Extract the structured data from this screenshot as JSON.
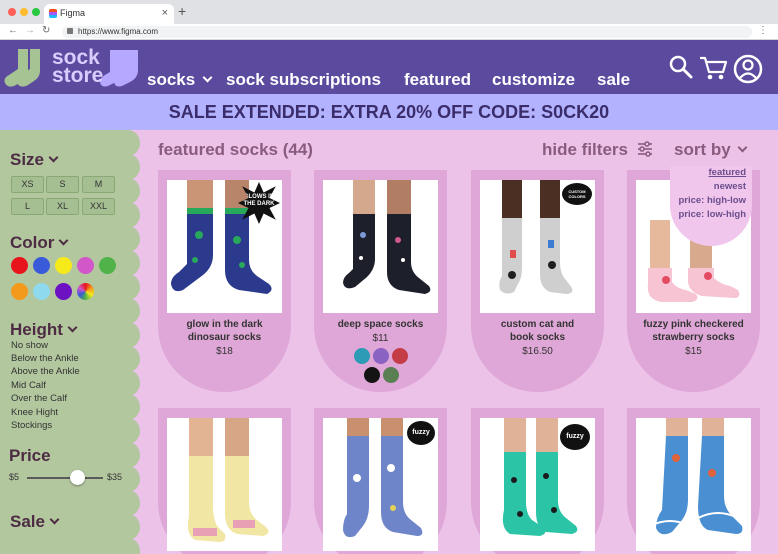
{
  "browser": {
    "tab_title": "Figma",
    "url": "https://www.figma.com"
  },
  "header": {
    "logo_text_line1": "sock",
    "logo_text_line2": "store",
    "nav": [
      {
        "label": "socks"
      },
      {
        "label": "sock subscriptions"
      },
      {
        "label": "featured"
      },
      {
        "label": "customize"
      },
      {
        "label": "sale"
      }
    ]
  },
  "banner": {
    "text": "SALE EXTENDED: EXTRA 20% OFF CODE: S0CK20"
  },
  "sidebar": {
    "size_label": "Size",
    "sizes": [
      "XS",
      "S",
      "M",
      "L",
      "XL",
      "XXL"
    ],
    "color_label": "Color",
    "colors": [
      "#e8141c",
      "#3a5bd9",
      "#f6ea1a",
      "#d257c8",
      "#4fb34a",
      "#f39a1d",
      "#8fd9ee",
      "#6d12c2",
      "multicolor"
    ],
    "height_label": "Height",
    "heights": [
      "No show",
      "Below the Ankle",
      "Above the Ankle",
      "Mid Calf",
      "Over the Calf",
      "Knee Hight",
      "Stockings"
    ],
    "price_label": "Price",
    "price_min": "$5",
    "price_max": "$35",
    "price_slider_fraction": 0.67,
    "sale_label": "Sale"
  },
  "content": {
    "title": "featured socks (44)",
    "hide_filters": "hide filters",
    "sort_by": "sort by",
    "sort_options": [
      "featured",
      "newest",
      "price: high-low",
      "price: low-high"
    ],
    "sort_selected": "featured"
  },
  "products": [
    {
      "name_line1": "glow in the dark",
      "name_line2": "dinosaur socks",
      "price": "$18",
      "badge": "GLOWS IN THE DARK",
      "sock_color": "#2b3a8c",
      "accent": "#28a85a",
      "bg": "#ffffff"
    },
    {
      "name_line1": "deep space socks",
      "name_line2": "",
      "price": "$11",
      "color_options": [
        "#2e9bb6",
        "#8a62c2",
        "#c43d46",
        "#141414",
        "#597f53"
      ],
      "sock_color": "#1d1f2b",
      "accent": "#7b9ad6",
      "bg": "#ffffff"
    },
    {
      "name_line1": "custom cat and",
      "name_line2": "book socks",
      "price": "$16.50",
      "badge": "CUSTOM COLORS",
      "sock_color": "#cfcfcf",
      "accent": "#1f1f1f",
      "bg": "#ffffff"
    },
    {
      "name_line1": "fuzzy pink checkered",
      "name_line2": "strawberry socks",
      "price": "$15",
      "sock_color": "#f7c4d4",
      "accent": "#e24b62",
      "bg": "#ffffff"
    },
    {
      "badge": "",
      "sock_color": "#f1e6a3",
      "accent": "#e8a0b4",
      "bg": "#ffffff"
    },
    {
      "badge": "fuzzy",
      "sock_color": "#6e86c9",
      "accent": "#ffffff",
      "bg": "#ffffff"
    },
    {
      "badge": "fuzzy",
      "sock_color": "#2cc4a6",
      "accent": "#1a1a1a",
      "bg": "#ffffff"
    },
    {
      "badge": "",
      "sock_color": "#4a8fd1",
      "accent": "#e0633b",
      "bg": "#ffffff"
    }
  ],
  "colors": {
    "header_bg": "#5c4a9e",
    "banner_bg": "#b2b2ff",
    "main_bg": "#ecc2e8",
    "sidebar_bg": "#b3c79f",
    "card_bg": "#dfa7d7"
  }
}
